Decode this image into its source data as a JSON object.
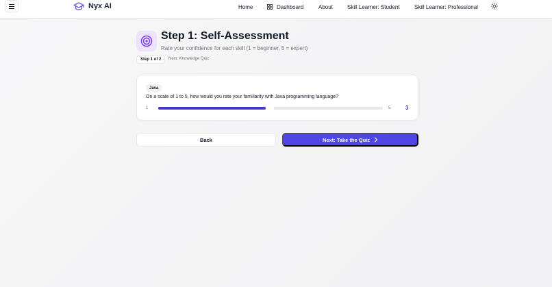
{
  "header": {
    "brand": "Nyx AI",
    "nav": {
      "home": "Home",
      "dashboard": "Dashboard",
      "about": "About",
      "student": "Skill Learner: Student",
      "professional": "Skill Learner: Professional"
    }
  },
  "assessment": {
    "title": "Step 1: Self-Assessment",
    "subtitle": "Rate your confidence for each skill (1 = beginner, 5 = expert)",
    "step_badge": "Step 1 of 2",
    "next_hint": "Next: Knowledge Quiz"
  },
  "question_card": {
    "skill": "Java",
    "question": "On a scale of 1 to 5, how would you rate your familiarity with Java programming language?",
    "slider": {
      "min_label": "1",
      "max_label": "5",
      "value": "3",
      "fill_fraction": 0.48
    }
  },
  "actions": {
    "back": "Back",
    "next": "Next: Take the Quiz"
  },
  "colors": {
    "accent": "#4f46e5",
    "accent_dark": "#4338ca",
    "icon_bg": "#ede4fb",
    "icon_color": "#7c3aed"
  },
  "icons": {
    "menu": "hamburger-icon",
    "brand": "graduation-cap-icon",
    "dashboard": "grid-icon",
    "theme": "sun-icon",
    "title": "target-icon",
    "next": "chevron-right-icon"
  }
}
